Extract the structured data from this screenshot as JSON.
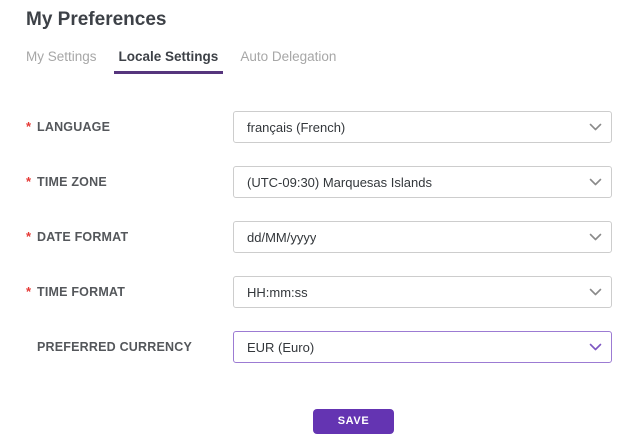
{
  "page": {
    "title": "My Preferences"
  },
  "tabs": [
    {
      "label": "My Settings",
      "active": false
    },
    {
      "label": "Locale Settings",
      "active": true
    },
    {
      "label": "Auto Delegation",
      "active": false
    }
  ],
  "form": {
    "fields": [
      {
        "label": "LANGUAGE",
        "marker": "*",
        "required": true,
        "value": "français (French)"
      },
      {
        "label": "TIME ZONE",
        "marker": "*",
        "required": true,
        "value": "(UTC-09:30) Marquesas Islands"
      },
      {
        "label": "DATE FORMAT",
        "marker": "*",
        "required": true,
        "value": "dd/MM/yyyy"
      },
      {
        "label": "TIME FORMAT",
        "marker": "*",
        "required": true,
        "value": "HH:mm:ss"
      },
      {
        "label": "PREFERRED CURRENCY",
        "marker": "",
        "required": false,
        "value": "EUR (Euro)",
        "focused": true
      }
    ],
    "save_label": "SAVE"
  },
  "colors": {
    "accent_purple": "#6434b2",
    "tab_underline_purple": "#56357d",
    "focus_border_purple": "#9c7bd3",
    "required_red": "#e53935",
    "label_gray": "#54575b",
    "text_dark": "#33373b",
    "tab_inactive_gray": "#a7a7a7",
    "border_gray": "#cdcdcd"
  }
}
